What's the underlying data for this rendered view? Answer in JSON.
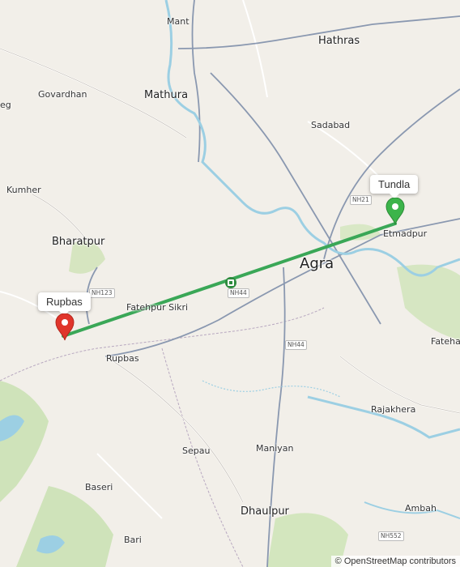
{
  "places": {
    "mant": "Mant",
    "hathras": "Hathras",
    "govardhan": "Govardhan",
    "mathura": "Mathura",
    "eg": "eg",
    "sadabad": "Sadabad",
    "kumher": "Kumher",
    "bharatpur": "Bharatpur",
    "agra": "Agra",
    "etmadpur": "Etmadpur",
    "fatehpur_sikri": "Fatehpur Sikri",
    "rupbas": "Rupbas",
    "fatehab": "Fatehab",
    "rajakhera": "Rajakhera",
    "sepau": "Sepau",
    "maniyan": "Maniyan",
    "baseri": "Baseri",
    "dhaulpur": "Dhaulpur",
    "ambah": "Ambah",
    "bari": "Bari"
  },
  "roads": {
    "nh21": "NH21",
    "nh44_a": "NH44",
    "nh44_b": "NH44",
    "nh123": "NH123",
    "nh552": "NH552"
  },
  "markers": {
    "start_label": "Rupbas",
    "end_label": "Tundla",
    "start_color": "#e0352b",
    "end_color": "#3cb44a",
    "route_color": "#3aa757"
  },
  "attribution": "© OpenStreetMap contributors"
}
